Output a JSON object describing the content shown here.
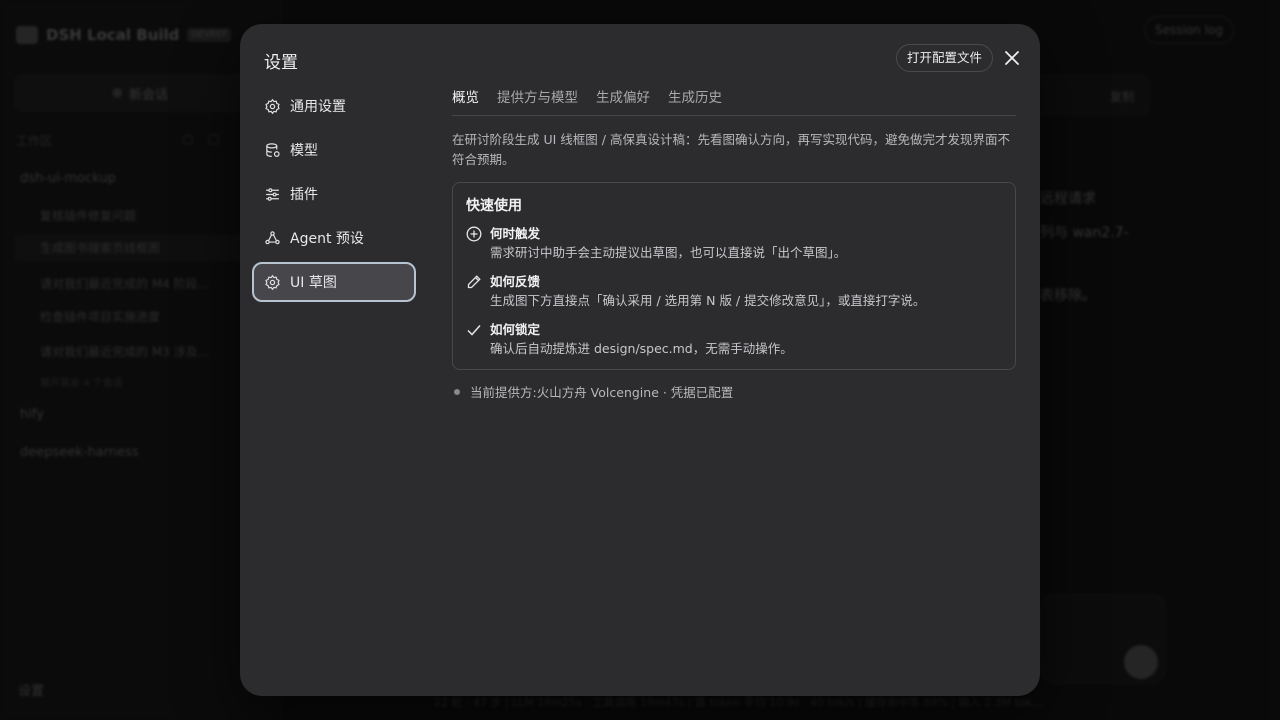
{
  "background": {
    "brand": "DSH Local Build",
    "brand_badge": "DEVREF",
    "new_chat": "新会话",
    "workspace_label": "工作区",
    "projects": [
      "dsh-ui-mockup",
      "hify",
      "deepseek-harness"
    ],
    "sessions": [
      "复核插件修复问题",
      "生成图书搜索页线框图",
      "请对我们最近完成的 M4 阶段...",
      "检查插件项目实施进度",
      "请对我们最近完成的 M3 涉及..."
    ],
    "more_sessions": "展开其余 4 个会话",
    "settings_label": "设置",
    "session_log": "Session log",
    "copy": "复制",
    "lines": [
      "远程请求",
      "列与 wan2.7-",
      "表移除。"
    ],
    "status_bar": "22 轮 · 47 步 | LLM 16m25s · 工具调用 19m47s | 首 token 平均 10.9s · 40 tok/s | 缓存命中率 89% | 输入 2.3M tok..."
  },
  "modal": {
    "title": "设置",
    "open_config": "打开配置文件",
    "close_icon": "close-icon",
    "nav": [
      {
        "label": "通用设置",
        "icon": "gear-icon"
      },
      {
        "label": "模型",
        "icon": "database-icon"
      },
      {
        "label": "插件",
        "icon": "sliders-icon"
      },
      {
        "label": "Agent 预设",
        "icon": "agent-icon"
      },
      {
        "label": "UI 草图",
        "icon": "gear-icon",
        "active": true
      }
    ],
    "tabs": [
      {
        "label": "概览",
        "active": true
      },
      {
        "label": "提供方与模型"
      },
      {
        "label": "生成偏好"
      },
      {
        "label": "生成历史"
      }
    ],
    "description": "在研讨阶段生成 UI 线框图 / 高保真设计稿：先看图确认方向，再写实现代码，避免做完才发现界面不符合预期。",
    "quick_start": {
      "title": "快速使用",
      "items": [
        {
          "icon": "plus-circle-icon",
          "heading": "何时触发",
          "body": "需求研讨中助手会主动提议出草图，也可以直接说「出个草图」。"
        },
        {
          "icon": "pencil-icon",
          "heading": "如何反馈",
          "body": "生成图下方直接点「确认采用 / 选用第 N 版 / 提交修改意见」，或直接打字说。"
        },
        {
          "icon": "check-icon",
          "heading": "如何锁定",
          "body": "确认后自动提炼进 design/spec.md，无需手动操作。"
        }
      ]
    },
    "provider_status": "当前提供方:火山方舟 Volcengine · 凭据已配置",
    "colors": {
      "modal_bg": "#2c2c2e",
      "active_border": "#b6c3d1",
      "active_bg": "#46464b"
    }
  }
}
